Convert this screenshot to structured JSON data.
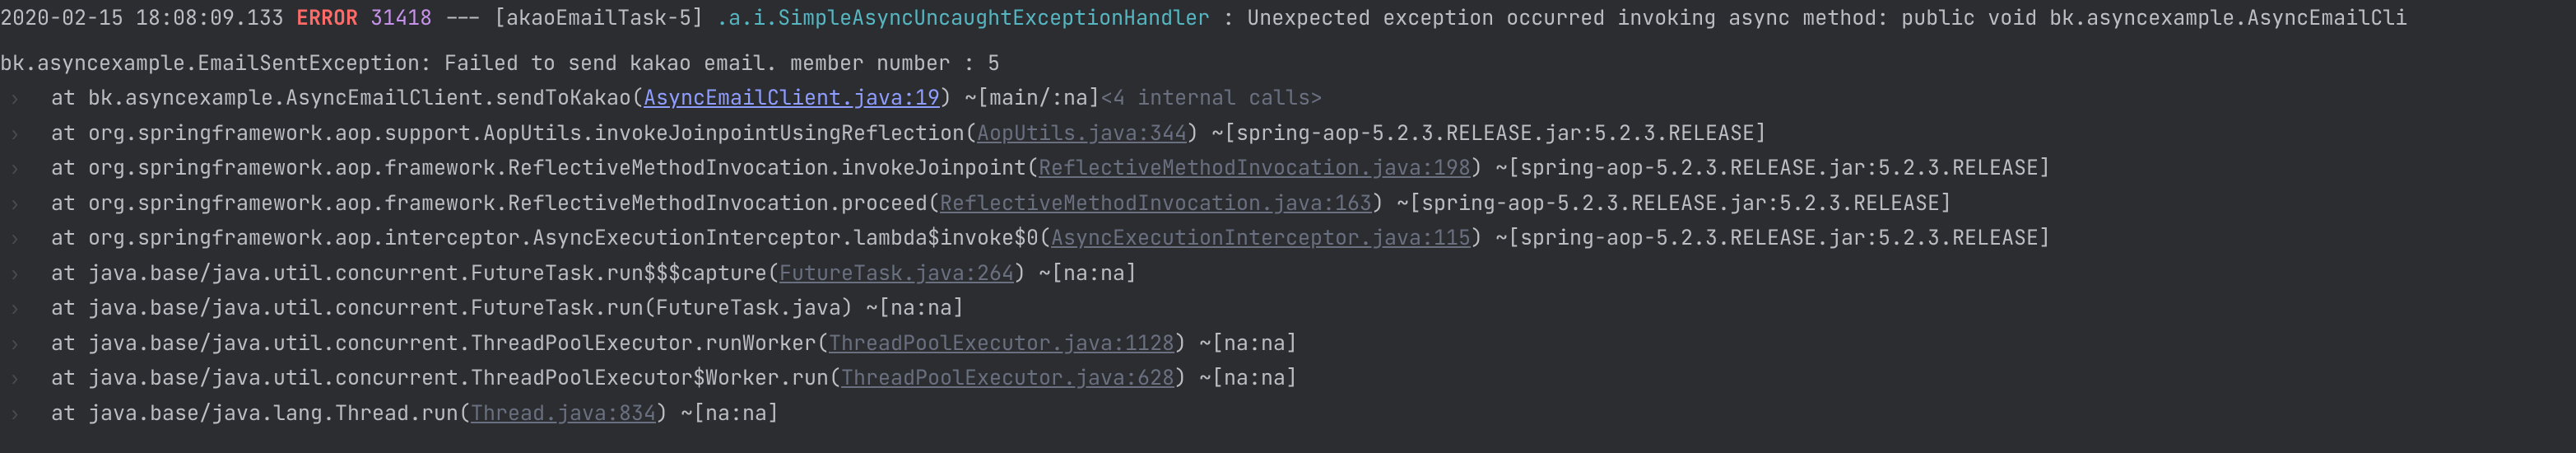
{
  "header": {
    "timestamp": "2020-02-15 18:08:09.133",
    "level": "ERROR",
    "pid": "31418",
    "separator": "---",
    "thread": "[akaoEmailTask-5]",
    "logger": ".a.i.SimpleAsyncUncaughtExceptionHandler",
    "colon": ":",
    "message": "Unexpected exception occurred invoking async method: public void bk.asyncexample.AsyncEmailCli"
  },
  "exception": "bk.asyncexample.EmailSentException: Failed to send kakao email. member number : 5",
  "stack": [
    {
      "prefix": "at bk.asyncexample.AsyncEmailClient.sendToKakao(",
      "link": "AsyncEmailClient.java:19",
      "linkBright": true,
      "suffix1": ") ~[main/:na]",
      "suffix2": " <4 internal calls>",
      "suffix2Dim": true
    },
    {
      "prefix": "at org.springframework.aop.support.AopUtils.invokeJoinpointUsingReflection(",
      "link": "AopUtils.java:344",
      "linkBright": false,
      "suffix1": ") ~[spring-aop-5.2.3.RELEASE.jar:5.2.3.RELEASE]"
    },
    {
      "prefix": "at org.springframework.aop.framework.ReflectiveMethodInvocation.invokeJoinpoint(",
      "link": "ReflectiveMethodInvocation.java:198",
      "linkBright": false,
      "suffix1": ") ~[spring-aop-5.2.3.RELEASE.jar:5.2.3.RELEASE]"
    },
    {
      "prefix": "at org.springframework.aop.framework.ReflectiveMethodInvocation.proceed(",
      "link": "ReflectiveMethodInvocation.java:163",
      "linkBright": false,
      "suffix1": ") ~[spring-aop-5.2.3.RELEASE.jar:5.2.3.RELEASE]"
    },
    {
      "prefix": "at org.springframework.aop.interceptor.AsyncExecutionInterceptor.lambda$invoke$0(",
      "link": "AsyncExecutionInterceptor.java:115",
      "linkBright": false,
      "suffix1": ") ~[spring-aop-5.2.3.RELEASE.jar:5.2.3.RELEASE]"
    },
    {
      "prefix": "at java.base/java.util.concurrent.FutureTask.run$$$capture(",
      "link": "FutureTask.java:264",
      "linkBright": false,
      "suffix1": ") ~[na:na]"
    },
    {
      "prefix": "at java.base/java.util.concurrent.FutureTask.run(FutureTask.java) ~[na:na]",
      "noLink": true
    },
    {
      "prefix": "at java.base/java.util.concurrent.ThreadPoolExecutor.runWorker(",
      "link": "ThreadPoolExecutor.java:1128",
      "linkBright": false,
      "suffix1": ") ~[na:na]"
    },
    {
      "prefix": "at java.base/java.util.concurrent.ThreadPoolExecutor$Worker.run(",
      "link": "ThreadPoolExecutor.java:628",
      "linkBright": false,
      "suffix1": ") ~[na:na]"
    },
    {
      "prefix": "at java.base/java.lang.Thread.run(",
      "link": "Thread.java:834",
      "linkBright": false,
      "suffix1": ") ~[na:na]",
      "cursor": true
    }
  ]
}
